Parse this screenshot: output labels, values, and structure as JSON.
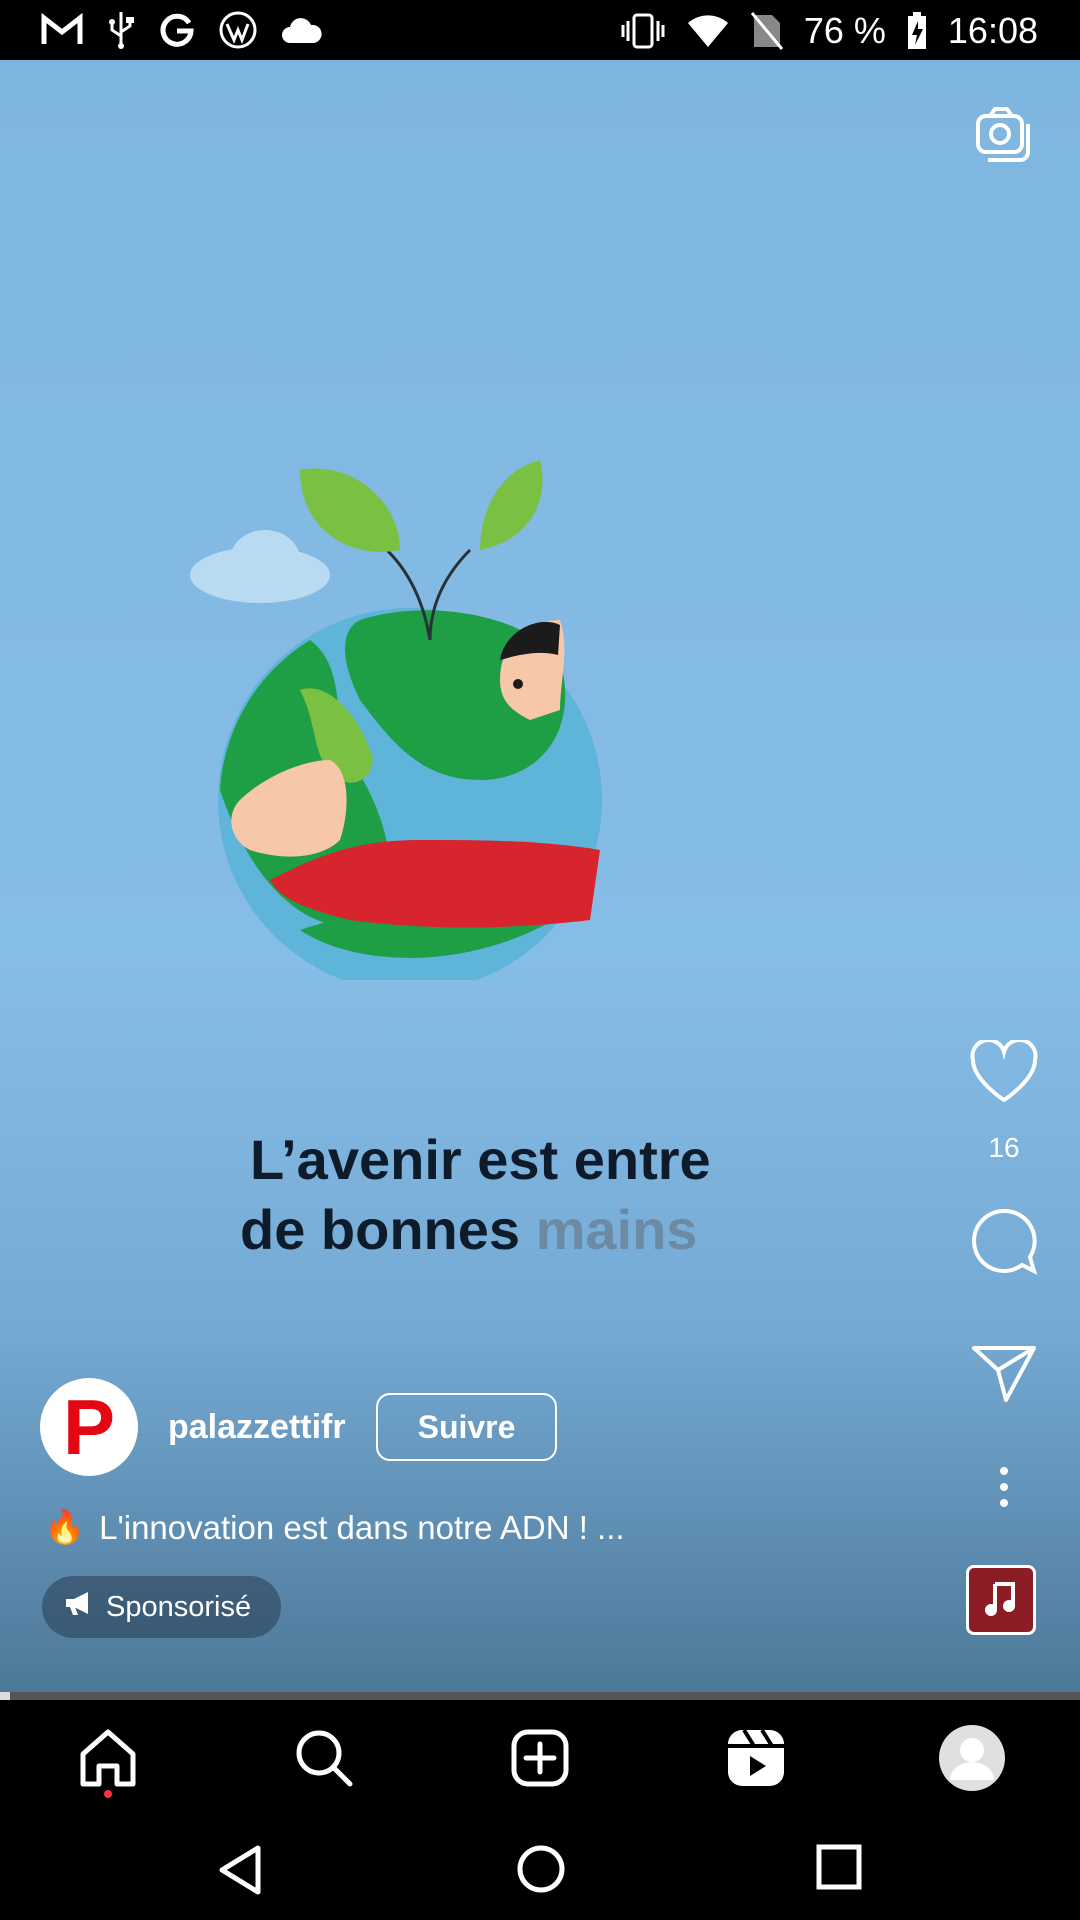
{
  "status_bar": {
    "left_icons": [
      "gmail-icon",
      "usb-icon",
      "google-icon",
      "wordpress-icon",
      "cloud-icon"
    ],
    "right_icons": [
      "vibrate-icon",
      "wifi-icon",
      "no-sim-icon",
      "battery-charging-icon"
    ],
    "battery": "76 %",
    "time": "16:08"
  },
  "video": {
    "overlay_line1": "L’avenir est entre",
    "overlay_line2a": "de bonnes ",
    "overlay_line2b": "mains"
  },
  "actions": {
    "like_icon": "heart-icon",
    "like_count": "16",
    "comment_icon": "comment-icon",
    "share_icon": "send-icon",
    "more_icon": "more-vertical-icon",
    "audio_icon": "music-note-icon"
  },
  "author": {
    "avatar_letter": "P",
    "username": "palazzettifr",
    "follow_label": "Suivre"
  },
  "caption": {
    "emoji": "🔥",
    "text": "L'innovation est dans notre ADN ! ..."
  },
  "sponsored": {
    "icon": "megaphone-icon",
    "label": "Sponsorisé"
  },
  "bottom_nav": [
    "home-icon",
    "search-icon",
    "create-icon",
    "reels-icon",
    "profile-icon"
  ],
  "system_nav": [
    "back-icon",
    "home-circle-icon",
    "recents-icon"
  ],
  "colors": {
    "video_bg": "#86bde6",
    "brand_red": "#e30613",
    "notification_dot": "#ff3040"
  }
}
